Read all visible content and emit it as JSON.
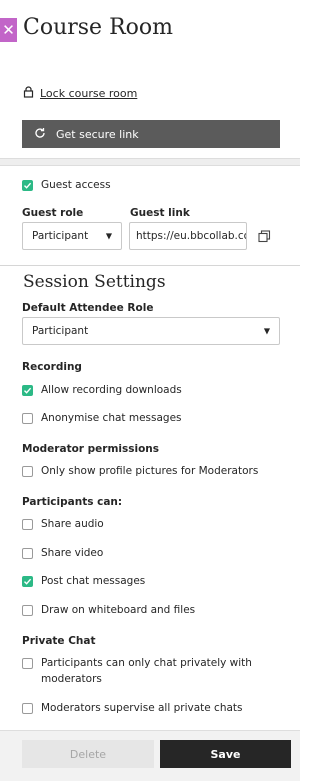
{
  "panel": {
    "title": "Course Room",
    "close_symbol": "✕"
  },
  "lock_link": "Lock course room",
  "secure_link_button": "Get secure link",
  "guest": {
    "access_label": "Guest access",
    "access_checked": true,
    "role_label": "Guest role",
    "role_value": "Participant",
    "link_label": "Guest link",
    "link_value": "https://eu.bbcollab.com"
  },
  "session": {
    "title": "Session Settings",
    "default_role_label": "Default Attendee Role",
    "default_role_value": "Participant",
    "recording": {
      "heading": "Recording",
      "items": [
        {
          "label": "Allow recording downloads",
          "checked": true
        },
        {
          "label": "Anonymise chat messages",
          "checked": false
        }
      ]
    },
    "moderator": {
      "heading": "Moderator permissions",
      "items": [
        {
          "label": "Only show profile pictures for Moderators",
          "checked": false
        }
      ]
    },
    "participants": {
      "heading": "Participants can:",
      "items": [
        {
          "label": "Share audio",
          "checked": false
        },
        {
          "label": "Share video",
          "checked": false
        },
        {
          "label": "Post chat messages",
          "checked": true
        },
        {
          "label": "Draw on whiteboard and files",
          "checked": false
        }
      ]
    },
    "private_chat": {
      "heading": "Private Chat",
      "items": [
        {
          "label": "Participants can only chat privately with moderators",
          "checked": false
        },
        {
          "label": "Moderators supervise all private chats",
          "checked": false
        }
      ]
    }
  },
  "footer": {
    "delete_label": "Delete",
    "save_label": "Save"
  },
  "colors": {
    "accent_check": "#2cb986",
    "close_bg": "#c265c8",
    "secure_btn": "#5b5b5b",
    "save_btn": "#262626"
  }
}
